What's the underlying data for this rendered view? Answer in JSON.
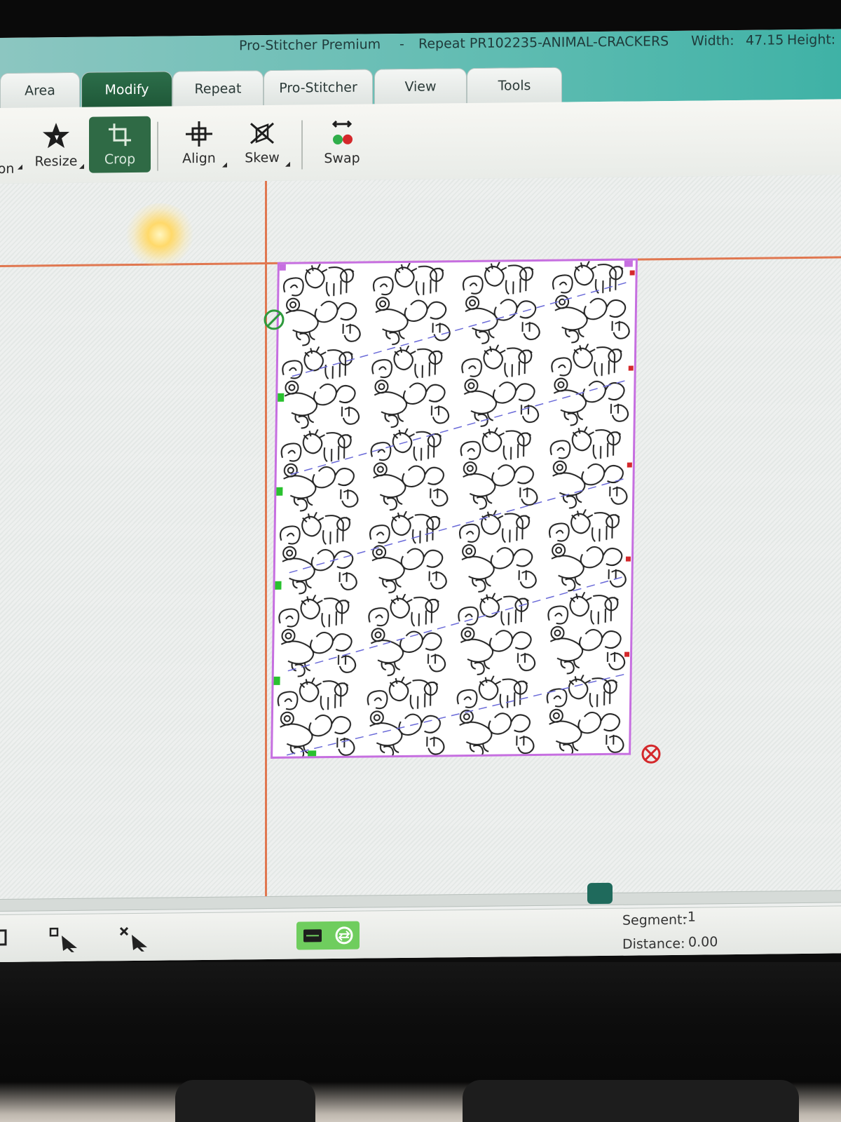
{
  "window": {
    "app_name": "Pro-Stitcher Premium",
    "separator": "-",
    "file_title": "Repeat PR102235-ANIMAL-CRACKERS",
    "width_label": "Width:",
    "width_value": "47.15",
    "height_label": "Height:"
  },
  "tabs": [
    {
      "label": "Area"
    },
    {
      "label": "Modify",
      "active": true
    },
    {
      "label": "Repeat"
    },
    {
      "label": "Pro-Stitcher"
    },
    {
      "label": "View"
    },
    {
      "label": "Tools"
    }
  ],
  "ribbon": {
    "partial_label": "ion",
    "resize_label": "Resize",
    "crop_label": "Crop",
    "align_label": "Align",
    "skew_label": "Skew",
    "swap_label": "Swap",
    "active_tool": "Crop"
  },
  "status": {
    "segment_label": "Segment:",
    "segment_value": "-1",
    "distance_label": "Distance:",
    "distance_value": "0.00"
  },
  "colors": {
    "accent_green": "#2f6a45",
    "guide_orange": "#e07750",
    "selection_magenta": "#c66fe0",
    "handle_green": "#29c12f",
    "titlebar_teal": "#3fb2a6"
  }
}
